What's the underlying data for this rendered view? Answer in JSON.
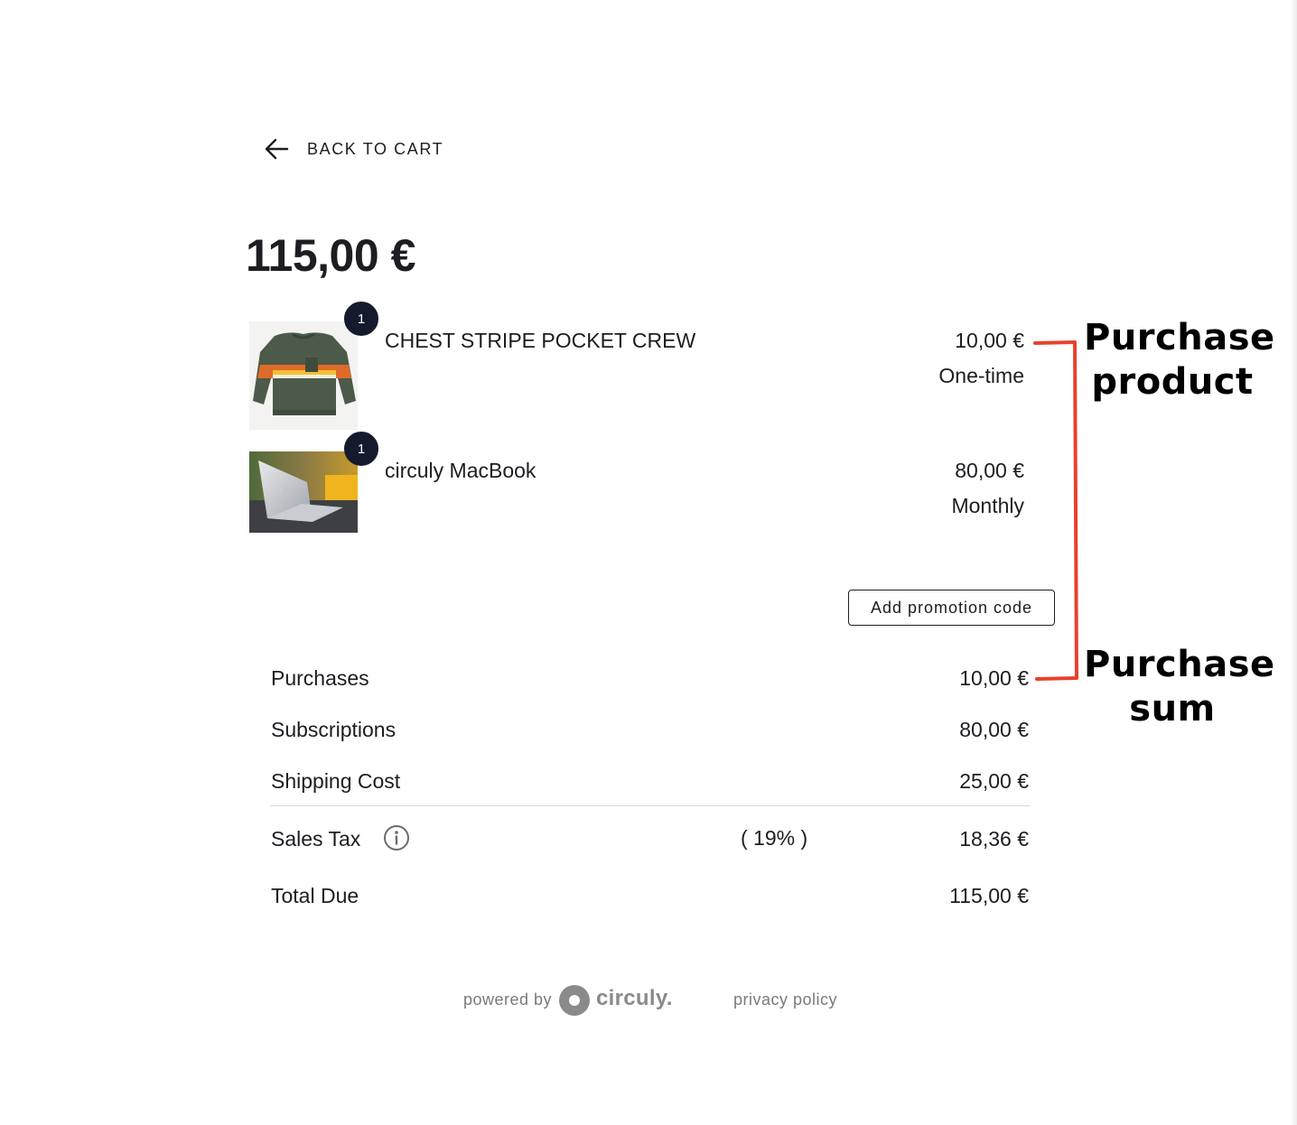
{
  "nav": {
    "back_label": "BACK TO CART"
  },
  "order": {
    "total": "115,00 €"
  },
  "items": [
    {
      "name": "CHEST STRIPE POCKET CREW",
      "quantity": "1",
      "price": "10,00 €",
      "period": "One-time",
      "image": "sweater"
    },
    {
      "name": "circuly MacBook",
      "quantity": "1",
      "price": "80,00 €",
      "period": "Monthly",
      "image": "laptop"
    }
  ],
  "promo": {
    "label": "Add promotion code"
  },
  "summary": {
    "purchases": {
      "label": "Purchases",
      "value": "10,00 €"
    },
    "subscriptions": {
      "label": "Subscriptions",
      "value": "80,00 €"
    },
    "shipping": {
      "label": "Shipping Cost",
      "value": "25,00 €"
    },
    "tax": {
      "label": "Sales Tax",
      "rate": "( 19% )",
      "value": "18,36 €",
      "icon": "info-icon"
    },
    "total_due": {
      "label": "Total Due",
      "value": "115,00 €"
    }
  },
  "footer": {
    "powered_by": "powered by",
    "brand": "circuly.",
    "privacy": "privacy policy"
  },
  "annotations": {
    "purchase_product": {
      "line1": "Purchase",
      "line2": "product"
    },
    "purchase_sum": {
      "line1": "Purchase",
      "line2": "sum"
    },
    "bracket_color": "#e8412c"
  }
}
